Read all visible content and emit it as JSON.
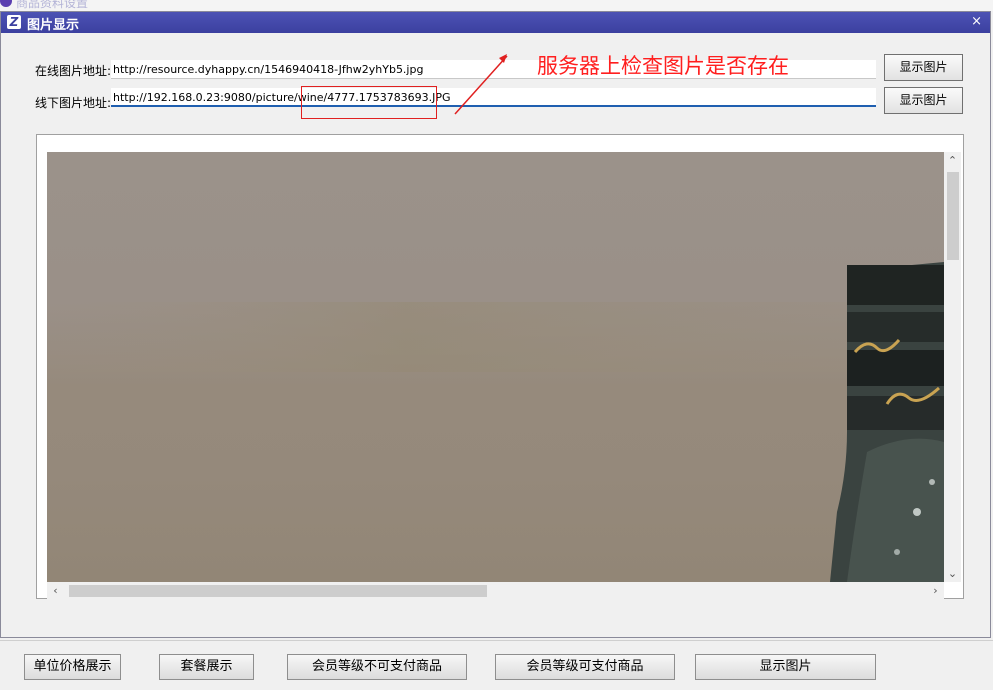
{
  "background_window": {
    "title": "商品资料设置"
  },
  "window": {
    "title": "图片显示",
    "icon_letter": "Z",
    "close_glyph": "×"
  },
  "form": {
    "online_label": "在线图片地址:",
    "online_url": "http://resource.dyhappy.cn/1546940418-Jfhw2yhYb5.jpg",
    "offline_label": "线下图片地址:",
    "offline_url": "http://192.168.0.23:9080/picture/wine/4777.1753783693.JPG",
    "show_button_1": "显示图片",
    "show_button_2": "显示图片"
  },
  "annotation": {
    "text": "服务器上检查图片是否存在",
    "color": "#ff1f1f"
  },
  "image_viewer": {
    "scroll_up": "⌃",
    "scroll_down": "⌄",
    "scroll_left": "‹",
    "scroll_right": "›"
  },
  "bottom_buttons": {
    "unit_price": "单位价格展示",
    "package": "套餐展示",
    "member_not_payable": "会员等级不可支付商品",
    "member_payable": "会员等级可支付商品",
    "show_image": "显示图片"
  },
  "colors": {
    "titlebar": "#4448a8",
    "focus_underline": "#1f5fb0"
  }
}
